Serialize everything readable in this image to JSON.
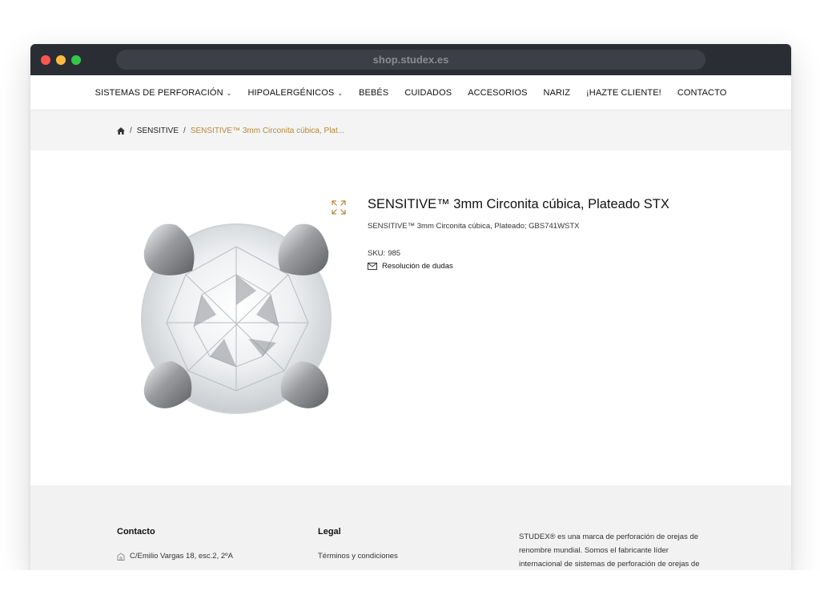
{
  "browser": {
    "url": "shop.studex.es"
  },
  "nav": {
    "items": [
      {
        "label": "SISTEMAS DE PERFORACIÓN",
        "dropdown": true
      },
      {
        "label": "HIPOALERGÉNICOS",
        "dropdown": true
      },
      {
        "label": "BEBÉS",
        "dropdown": false
      },
      {
        "label": "CUIDADOS",
        "dropdown": false
      },
      {
        "label": "ACCESORIOS",
        "dropdown": false
      },
      {
        "label": "NARIZ",
        "dropdown": false
      },
      {
        "label": "¡HAZTE CLIENTE!",
        "dropdown": false
      },
      {
        "label": "CONTACTO",
        "dropdown": false
      }
    ]
  },
  "breadcrumb": {
    "home_icon": "home-icon",
    "separator": "/",
    "category": "SENSITIVE",
    "current": "SENSITIVE™ 3mm Circonita cúbica, Plat..."
  },
  "product": {
    "title": "SENSITIVE™ 3mm Circonita cúbica, Plateado STX",
    "subtitle": "SENSITIVE™ 3mm Circonita cúbica, Plateado; GBS741WSTX",
    "sku_label": "SKU:",
    "sku_value": "985",
    "help_label": "Resolución de dudas",
    "image_icon": "crystal-earring-image"
  },
  "footer": {
    "contact_heading": "Contacto",
    "address": "C/Emilio Vargas 18, esc.2, 2ºA",
    "legal_heading": "Legal",
    "legal_link": "Términos y condiciones",
    "about_text": "STUDEX® es una marca de perforación de orejas de renombre mundial. Somos el fabricante líder internacional de sistemas de perforación de orejas de"
  },
  "colors": {
    "accent": "#b28a3a",
    "titlebar": "#2b2d35"
  }
}
